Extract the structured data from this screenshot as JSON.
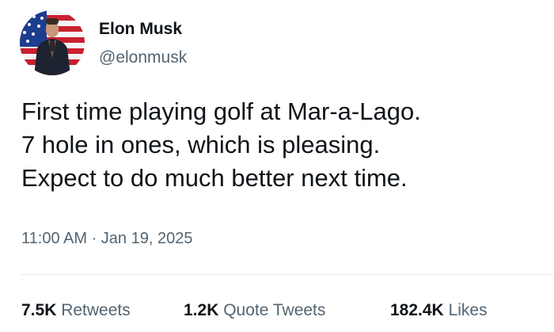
{
  "author": {
    "display_name": "Elon Musk",
    "handle": "@elonmusk",
    "avatar_icon": "profile-photo-with-flag-background"
  },
  "tweet": {
    "lines": [
      "First time playing golf at Mar-a-Lago.",
      "7 hole in ones, which is pleasing.",
      "Expect to do much better next time."
    ],
    "timestamp": "11:00 AM · Jan 19, 2025"
  },
  "stats": {
    "retweets": {
      "count": "7.5K",
      "label": "Retweets"
    },
    "quote_tweets": {
      "count": "1.2K",
      "label": "Quote Tweets"
    },
    "likes": {
      "count": "182.4K",
      "label": "Likes"
    }
  },
  "colors": {
    "text_primary": "#0f1419",
    "text_secondary": "#536471",
    "divider": "#e4e7ea"
  }
}
